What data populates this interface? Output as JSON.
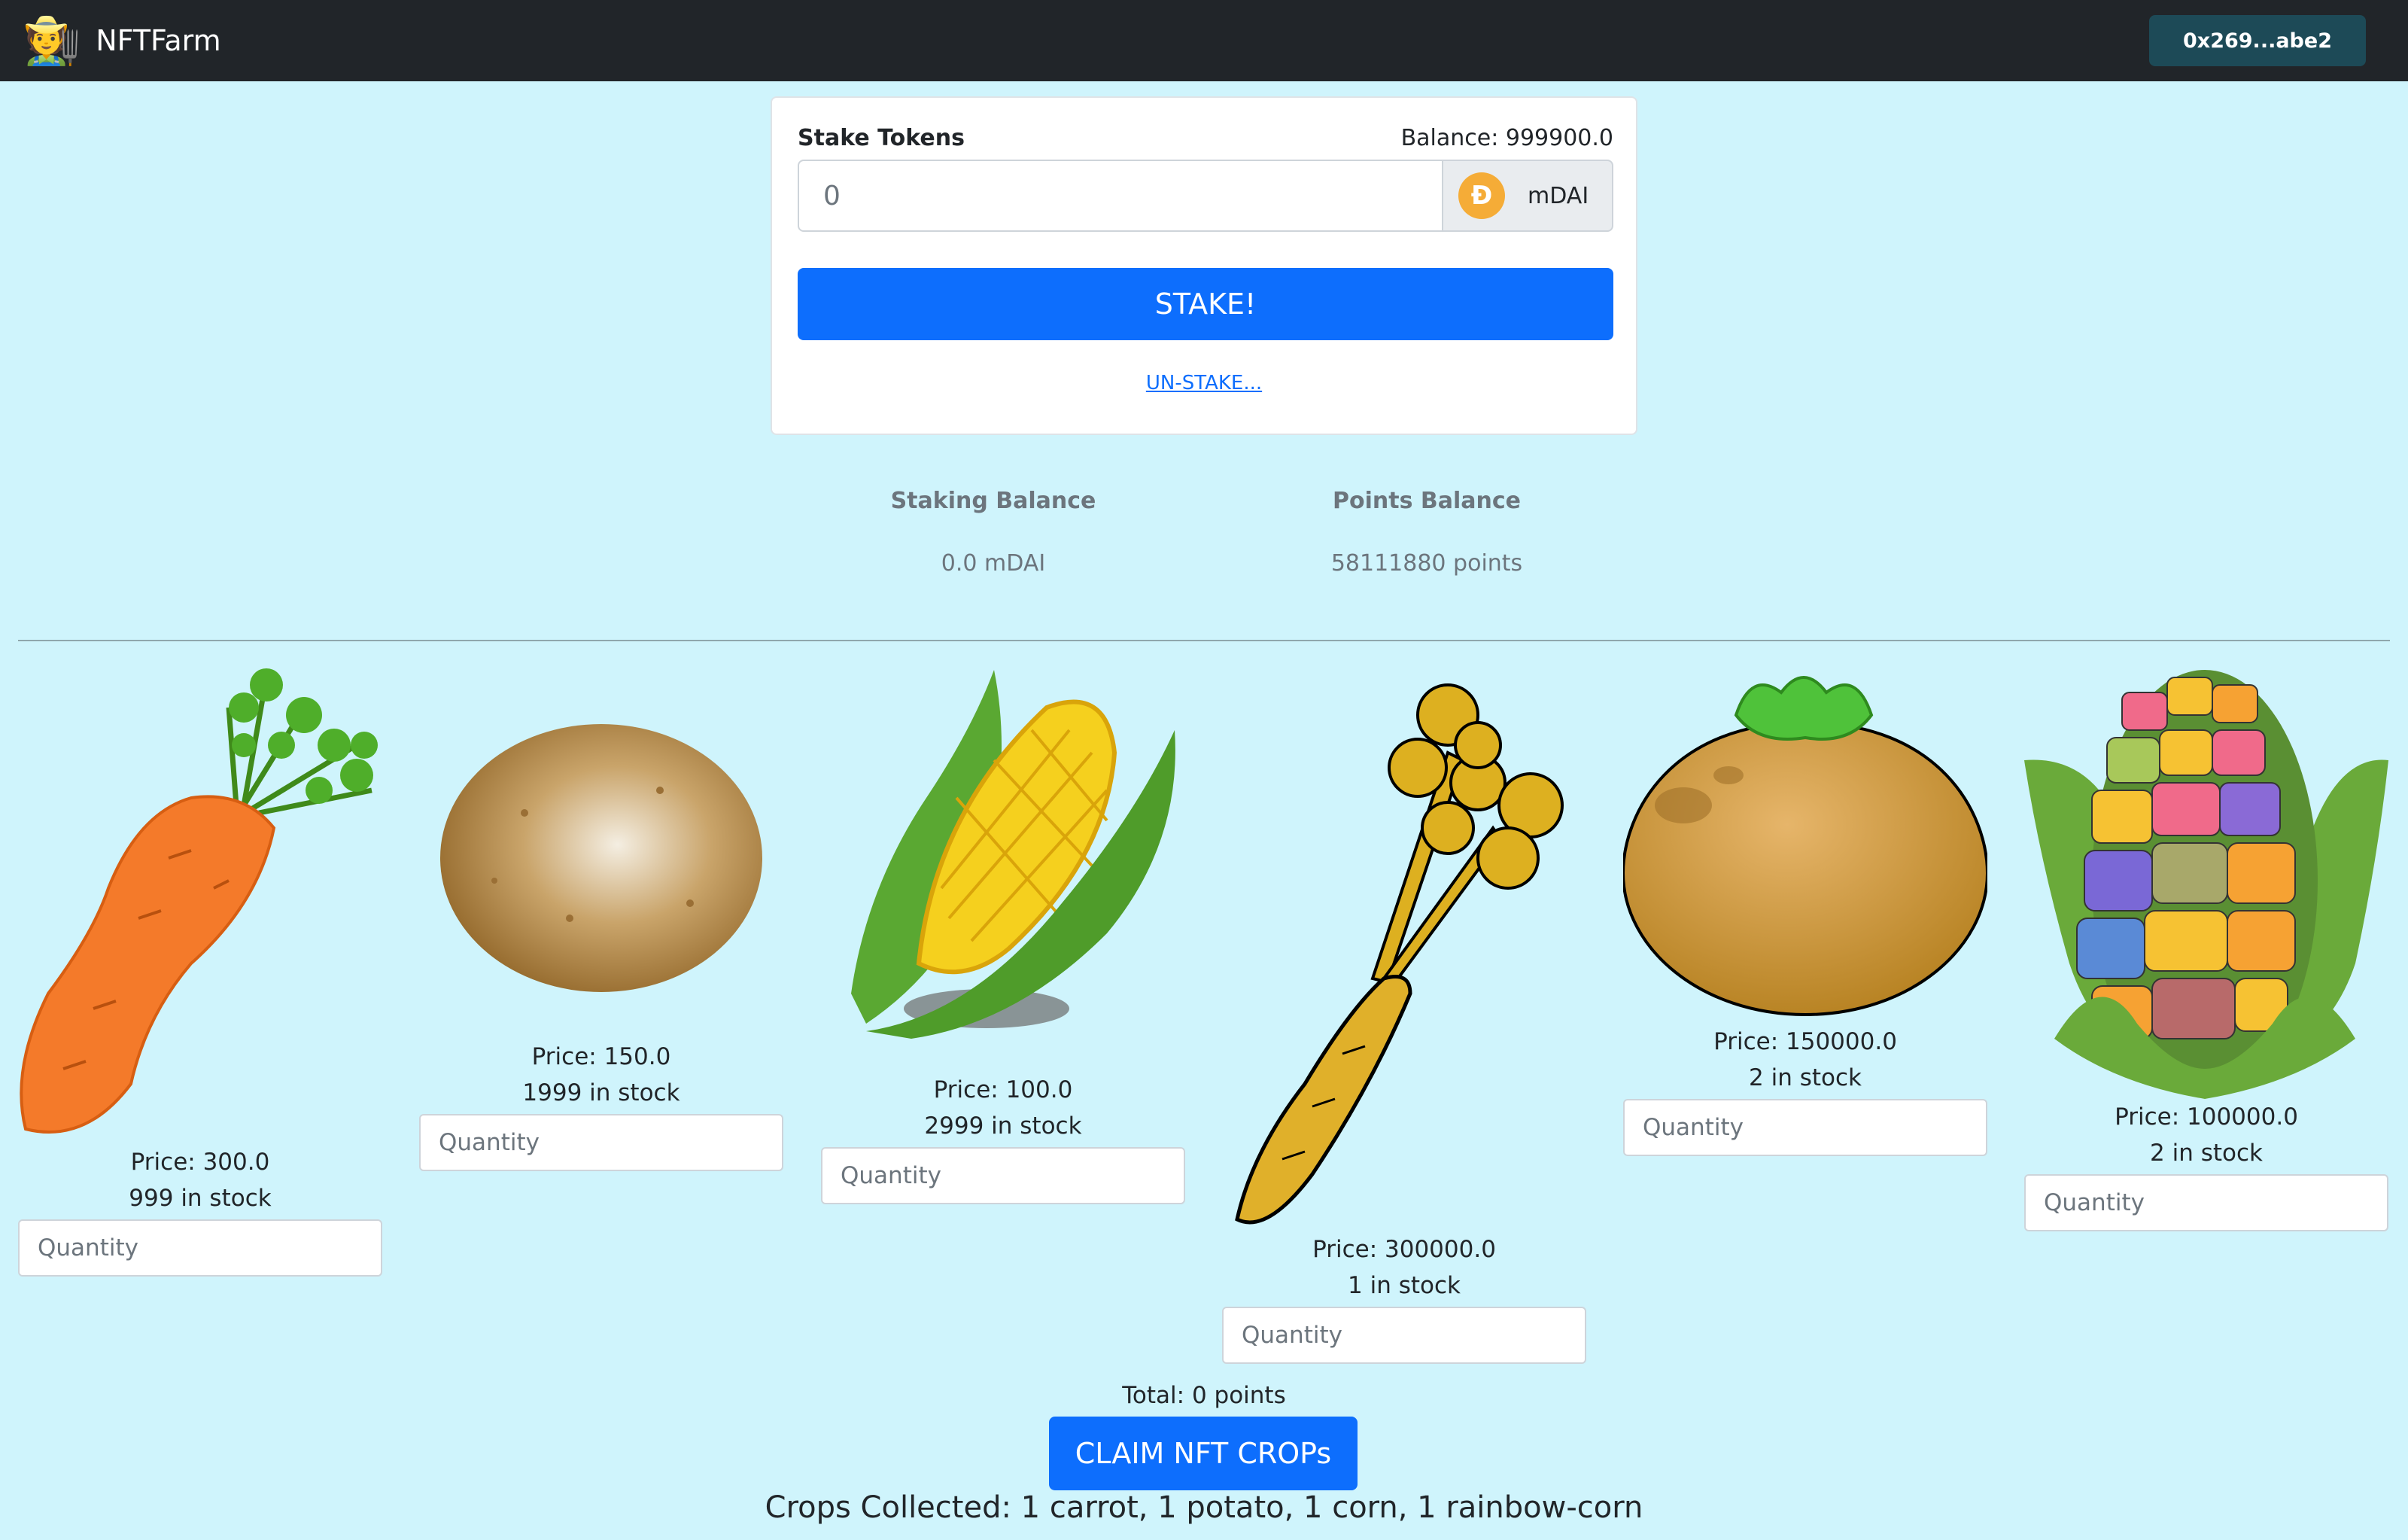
{
  "navbar": {
    "brand_name": "NFTFarm",
    "brand_icon": "farmer-emoji",
    "account_label": "0x269...abe2"
  },
  "stake": {
    "label": "Stake Tokens",
    "balance_text": "Balance: 999900.0",
    "input_value": "0",
    "token_symbol": "mDAI",
    "token_icon": "dai-coin-icon",
    "stake_button": "STAKE!",
    "unstake_link": "UN-STAKE..."
  },
  "balances": {
    "staking_title": "Staking Balance",
    "staking_value": "0.0 mDAI",
    "points_title": "Points Balance",
    "points_value": "58111880 points"
  },
  "crops": [
    {
      "icon": "carrot-icon",
      "price": "Price: 300.0",
      "stock": "999 in stock",
      "placeholder": "Quantity"
    },
    {
      "icon": "potato-icon",
      "price": "Price: 150.0",
      "stock": "1999 in stock",
      "placeholder": "Quantity"
    },
    {
      "icon": "corn-icon",
      "price": "Price: 100.0",
      "stock": "2999 in stock",
      "placeholder": "Quantity"
    },
    {
      "icon": "golden-carrot-icon",
      "price": "Price: 300000.0",
      "stock": "1 in stock",
      "placeholder": "Quantity"
    },
    {
      "icon": "golden-potato-icon",
      "price": "Price: 150000.0",
      "stock": "2 in stock",
      "placeholder": "Quantity"
    },
    {
      "icon": "rainbow-corn-icon",
      "price": "Price: 100000.0",
      "stock": "2 in stock",
      "placeholder": "Quantity"
    }
  ],
  "footer": {
    "total": "Total: 0 points",
    "claim_button": "CLAIM NFT CROPs",
    "collected": "Crops Collected: 1 carrot, 1 potato, 1 corn, 1 rainbow-corn"
  },
  "colors": {
    "background": "#cff4fc",
    "navbar": "#212529",
    "primary": "#0d6efd",
    "account_button": "#1d4a57"
  }
}
